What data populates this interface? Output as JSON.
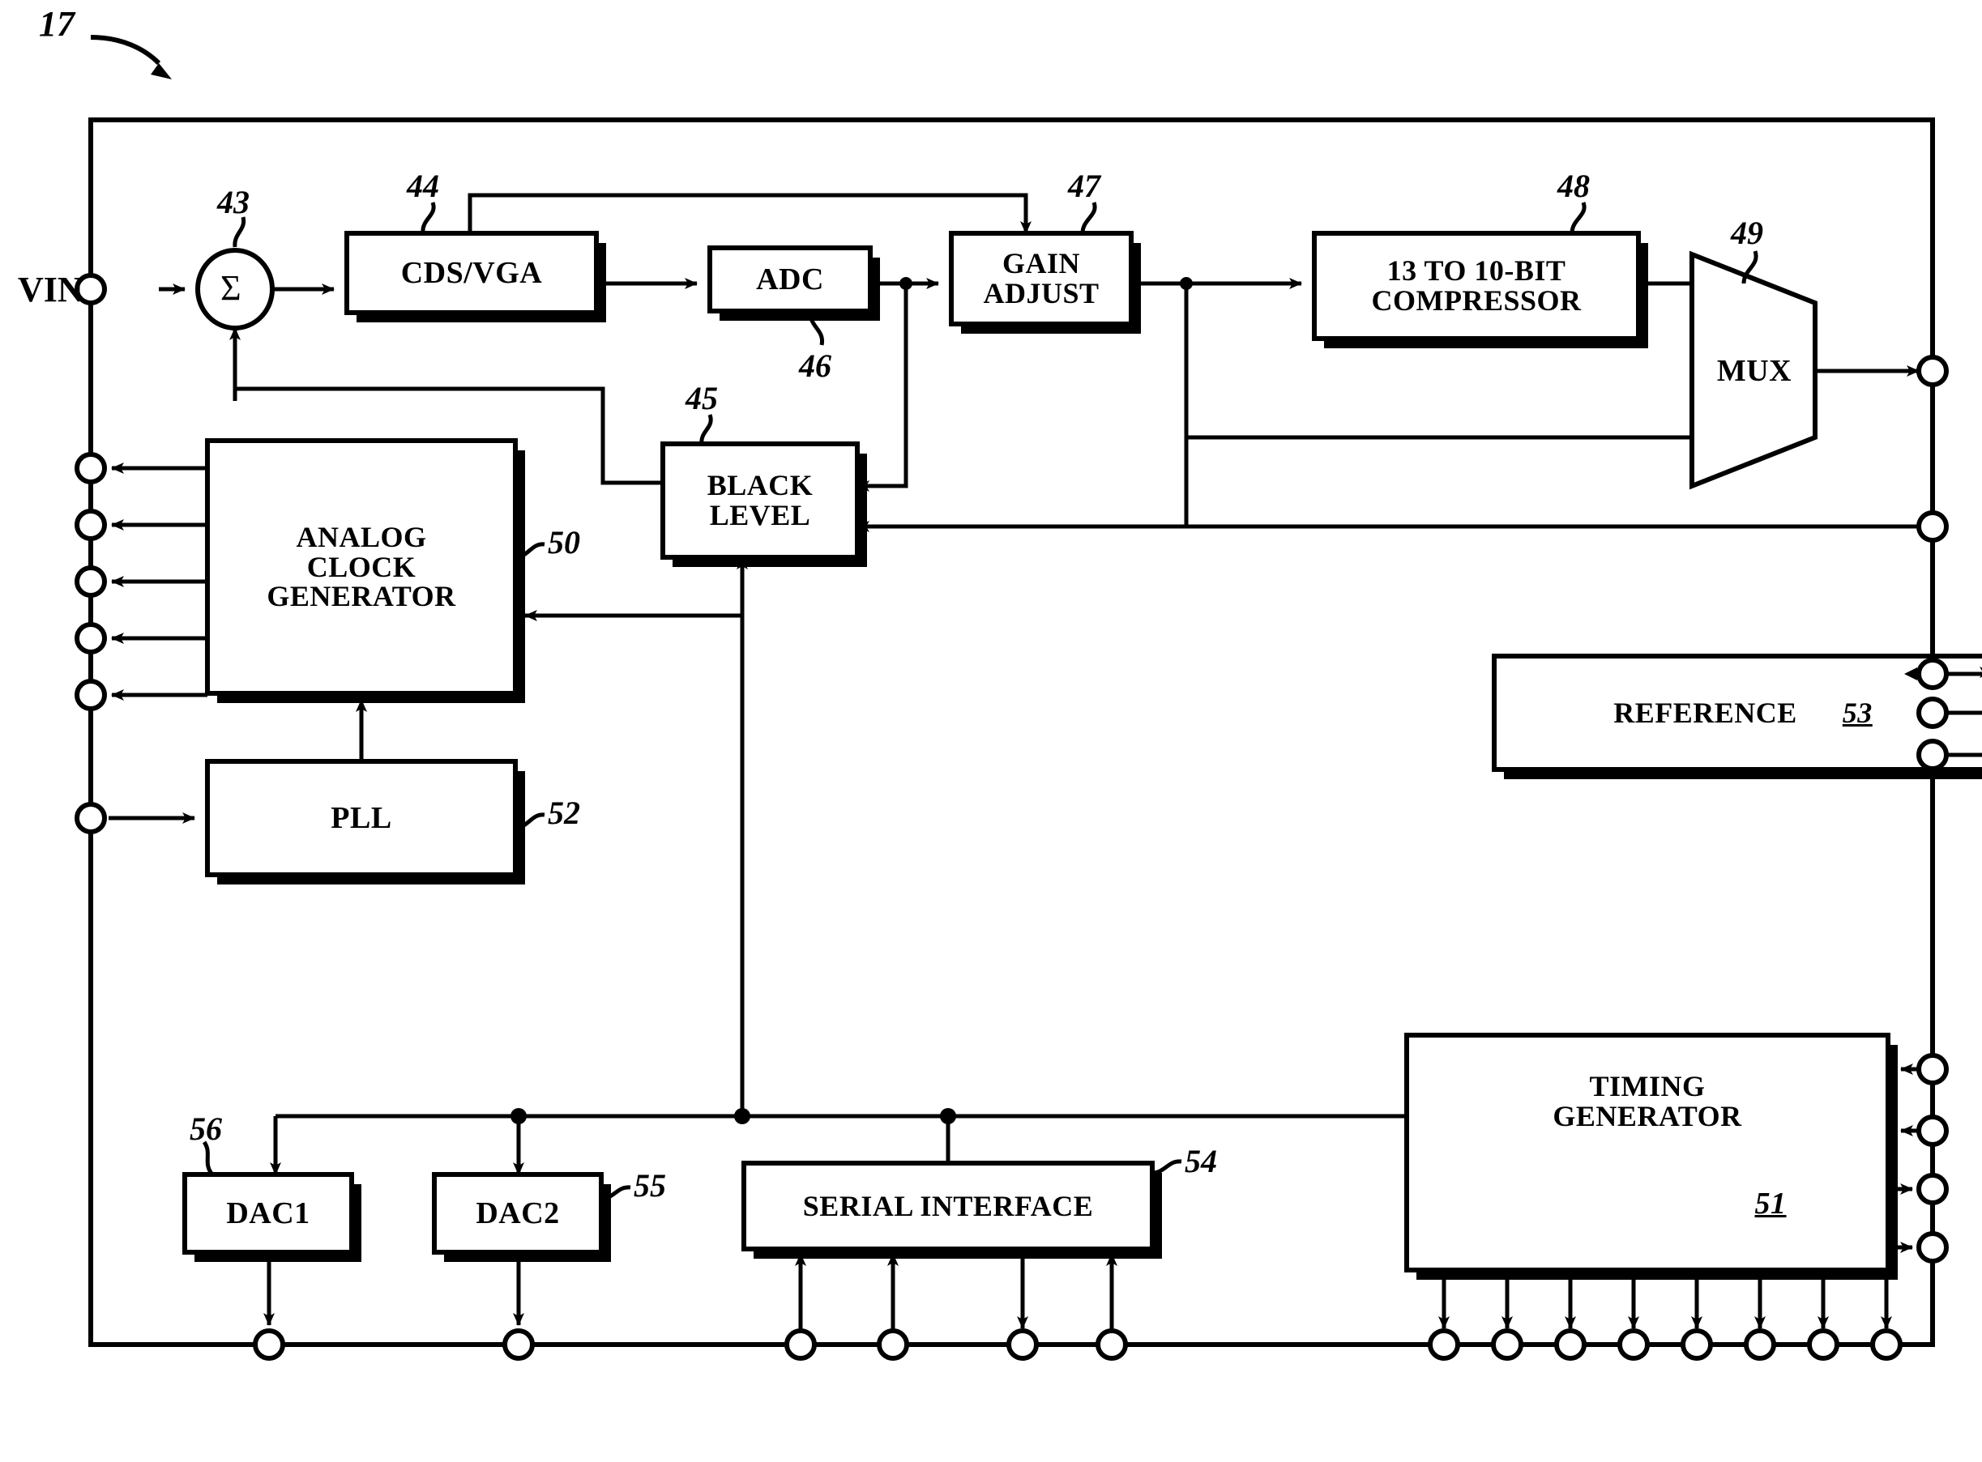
{
  "figure": {
    "title_ref": "17",
    "input_label": "VIN",
    "summing_node_symbol": "Σ"
  },
  "blocks": [
    {
      "id": "summer",
      "label": "Σ",
      "ref": "43"
    },
    {
      "id": "cds_vga",
      "label": "CDS/VGA",
      "ref": "44"
    },
    {
      "id": "adc",
      "label": "ADC",
      "ref": "46"
    },
    {
      "id": "gain",
      "label": "GAIN\nADJUST",
      "ref": "47"
    },
    {
      "id": "compressor",
      "label": "13 TO 10-BIT\nCOMPRESSOR",
      "ref": "48"
    },
    {
      "id": "mux",
      "label": "MUX",
      "ref": "49"
    },
    {
      "id": "black",
      "label": "BLACK\nLEVEL",
      "ref": "45"
    },
    {
      "id": "acg",
      "label": "ANALOG\nCLOCK\nGENERATOR",
      "ref": "50"
    },
    {
      "id": "pll",
      "label": "PLL",
      "ref": "52"
    },
    {
      "id": "reference",
      "label": "REFERENCE",
      "ref": "53"
    },
    {
      "id": "timing",
      "label": "TIMING\nGENERATOR",
      "ref": "51"
    },
    {
      "id": "serial",
      "label": "SERIAL INTERFACE",
      "ref": "54"
    },
    {
      "id": "dac1",
      "label": "DAC1",
      "ref": "56"
    },
    {
      "id": "dac2",
      "label": "DAC2",
      "ref": "55"
    }
  ],
  "labels": {
    "vin": "VIN",
    "sigma": "Σ",
    "cds_vga": "CDS/VGA",
    "adc": "ADC",
    "gain_line1": "GAIN",
    "gain_line2": "ADJUST",
    "comp_line1": "13 TO 10-BIT",
    "comp_line2": "COMPRESSOR",
    "mux": "MUX",
    "black_line1": "BLACK",
    "black_line2": "LEVEL",
    "acg_line1": "ANALOG",
    "acg_line2": "CLOCK",
    "acg_line3": "GENERATOR",
    "pll": "PLL",
    "reference": "REFERENCE",
    "timing_line1": "TIMING",
    "timing_line2": "GENERATOR",
    "serial": "SERIAL INTERFACE",
    "dac1": "DAC1",
    "dac2": "DAC2"
  },
  "ref_numbers": {
    "fig": "17",
    "summer": "43",
    "cds_vga": "44",
    "black_level": "45",
    "adc": "46",
    "gain_adjust": "47",
    "compressor": "48",
    "mux": "49",
    "analog_clock_generator": "50",
    "timing_generator": "51",
    "pll": "52",
    "reference": "53",
    "serial_interface": "54",
    "dac2": "55",
    "dac1": "56"
  },
  "colors": {
    "ink": "#000000",
    "paper": "#ffffff"
  }
}
